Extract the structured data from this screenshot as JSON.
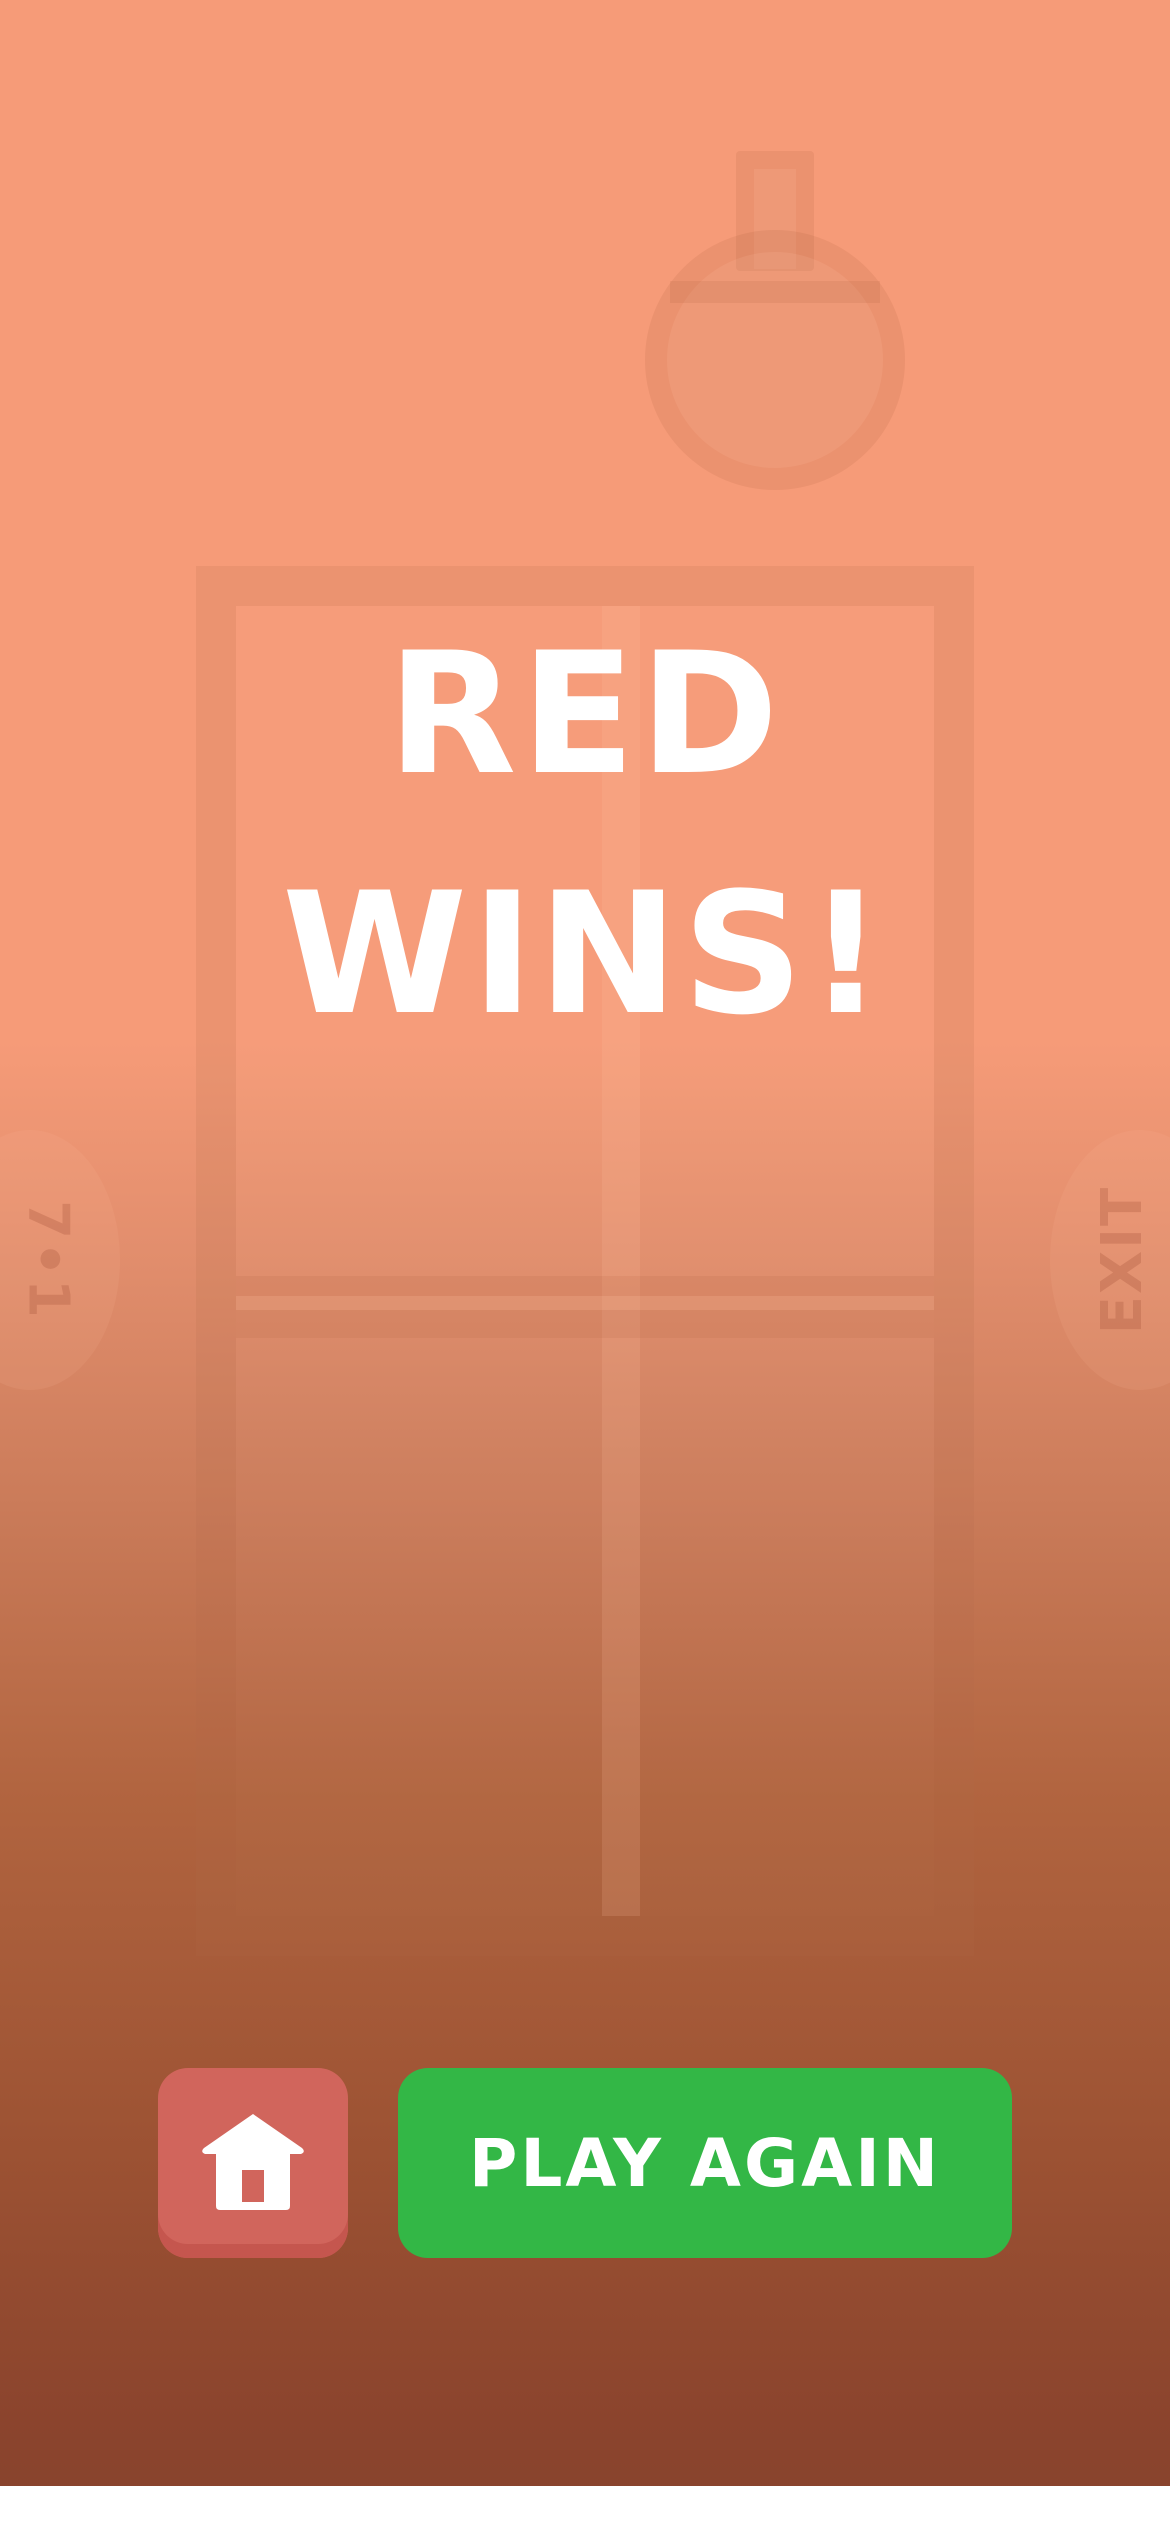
{
  "result": {
    "line1": "RED",
    "line2": "WINS!"
  },
  "side_labels": {
    "left": "7•1",
    "right": "EXIT"
  },
  "buttons": {
    "home_icon": "home-icon",
    "play_again": "PLAY AGAIN"
  },
  "colors": {
    "background_top": "#f69b78",
    "background_bottom": "#87432d",
    "home_button": "#d1655c",
    "play_button": "#33b746",
    "text": "#ffffff"
  }
}
